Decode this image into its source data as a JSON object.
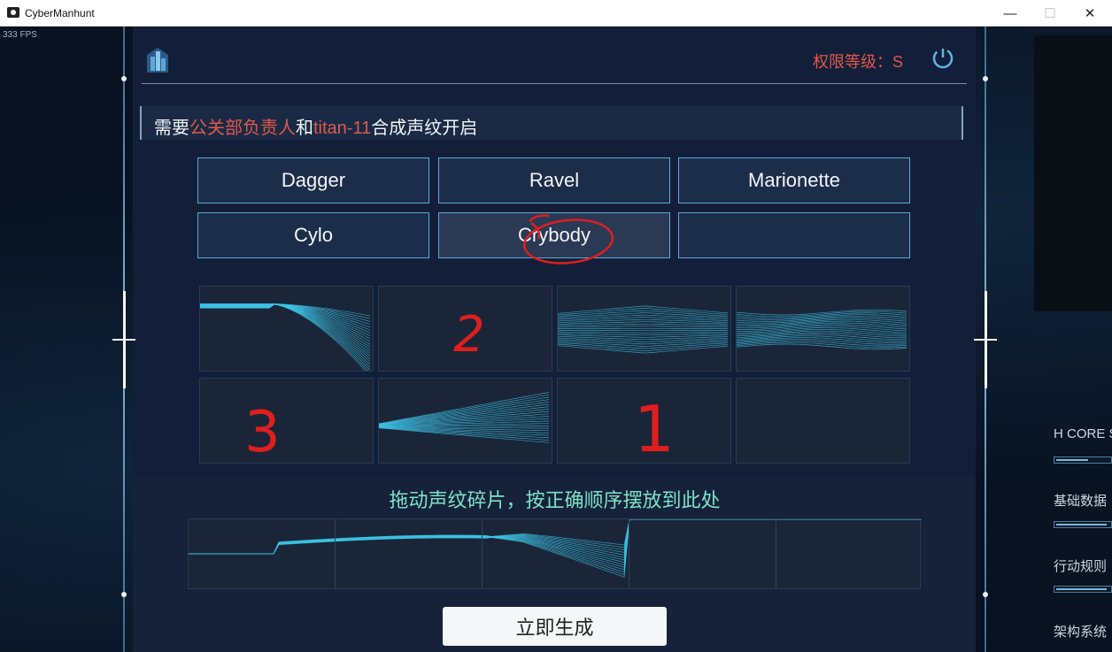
{
  "window": {
    "title": "CyberManhunt",
    "minimize": "—",
    "maximize": "☐",
    "close": "✕"
  },
  "fps": "333 FPS",
  "header": {
    "permission": "权限等级：S"
  },
  "prompt": {
    "p1": "需要",
    "p2": "公关部负责人",
    "p3": "和",
    "p4": "titan-11",
    "p5": "合成声纹开启"
  },
  "options": [
    {
      "label": "Dagger"
    },
    {
      "label": "Ravel"
    },
    {
      "label": "Marionette"
    },
    {
      "label": "Cylo"
    },
    {
      "label": "Crybody",
      "selected": true
    },
    {
      "label": ""
    }
  ],
  "annotations": [
    "2",
    "3",
    "1"
  ],
  "drop_zone": {
    "instruction": "拖动声纹碎片，按正确顺序摆放到此处"
  },
  "generate_button": "立即生成",
  "right_panel": {
    "labels": [
      "H CORE S",
      "基础数据",
      "行动规则",
      "架构系统"
    ],
    "levels": [
      0.6,
      0.95,
      0.95
    ]
  },
  "colors": {
    "accent": "#5fa8d8",
    "highlight": "#e0584a",
    "instruction": "#7fe0c8",
    "wave": "#3fc6e8"
  }
}
